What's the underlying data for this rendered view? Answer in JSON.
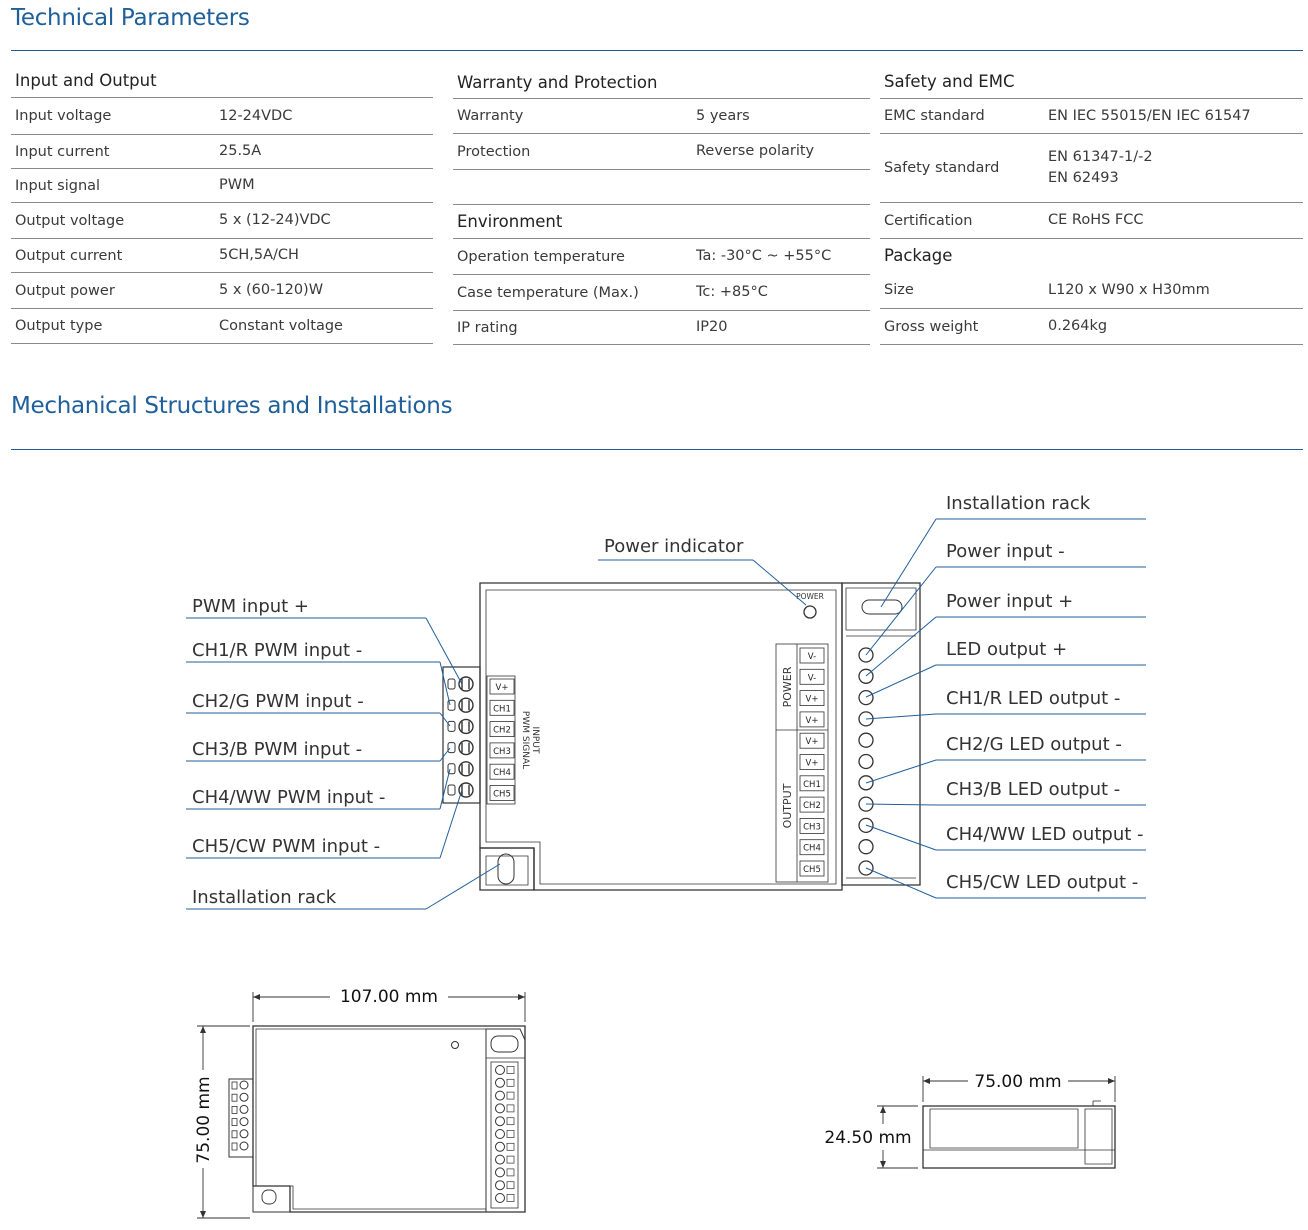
{
  "section1": {
    "title": "Technical Parameters"
  },
  "section2": {
    "title": "Mechanical Structures and Installations"
  },
  "input_output": {
    "heading": "Input and Output",
    "rows": [
      {
        "k": "Input voltage",
        "v": "12-24VDC"
      },
      {
        "k": "Input current",
        "v": "25.5A"
      },
      {
        "k": "Input signal",
        "v": "PWM"
      },
      {
        "k": "Output voltage",
        "v": "5 x (12-24)VDC"
      },
      {
        "k": "Output current",
        "v": "5CH,5A/CH"
      },
      {
        "k": "Output power",
        "v": "5 x (60-120)W"
      },
      {
        "k": "Output type",
        "v": "Constant voltage"
      }
    ]
  },
  "warranty": {
    "heading": "Warranty and Protection",
    "rows": [
      {
        "k": "Warranty",
        "v": "5 years"
      },
      {
        "k": "Protection",
        "v": "Reverse polarity"
      }
    ]
  },
  "environment": {
    "heading": "Environment",
    "rows": [
      {
        "k": "Operation temperature",
        "v": "Ta: -30°C ~ +55°C"
      },
      {
        "k": "Case temperature (Max.)",
        "v": "Tc: +85°C"
      },
      {
        "k": "IP rating",
        "v": "IP20"
      }
    ]
  },
  "safety": {
    "heading": "Safety and EMC",
    "rows": [
      {
        "k": "EMC standard",
        "v": "EN IEC 55015/EN IEC 61547"
      },
      {
        "k": "Safety standard",
        "v": "EN 61347-1/-2\nEN 62493"
      },
      {
        "k": "Certification",
        "v": "CE RoHS FCC"
      }
    ]
  },
  "package": {
    "heading": "Package",
    "rows": [
      {
        "k": "Size",
        "v": "L120 x W90 x H30mm"
      },
      {
        "k": "Gross weight",
        "v": "0.264kg"
      }
    ]
  },
  "diagram": {
    "left_labels": [
      "PWM input +",
      "CH1/R PWM input -",
      "CH2/G PWM input -",
      "CH3/B PWM input -",
      "CH4/WW PWM input -",
      "CH5/CW PWM input -",
      "Installation rack"
    ],
    "right_labels": [
      "Installation rack",
      "Power input -",
      "Power input +",
      "LED output +",
      "CH1/R LED output -",
      "CH2/G LED output -",
      "CH3/B LED output -",
      "CH4/WW LED output -",
      "CH5/CW LED output -"
    ],
    "top_label": "Power indicator",
    "power_small": "POWER",
    "input_terminals": [
      "V+",
      "CH1",
      "CH2",
      "CH3",
      "CH4",
      "CH5"
    ],
    "input_caption_1": "INPUT",
    "input_caption_2": "PWM SIGNAL",
    "power_terminals": [
      "V-",
      "V-",
      "V+",
      "V+"
    ],
    "output_terminals": [
      "V+",
      "V+",
      "CH1",
      "CH2",
      "CH3",
      "CH4",
      "CH5"
    ],
    "power_caption": "POWER",
    "output_caption": "OUTPUT",
    "dim_width": "107.00 mm",
    "dim_height": "75.00 mm",
    "dim_side_width": "75.00 mm",
    "dim_side_height": "24.50 mm"
  }
}
